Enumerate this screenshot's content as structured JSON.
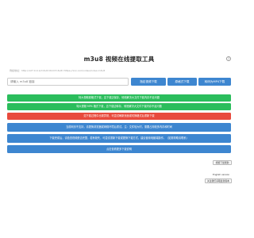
{
  "header": {
    "title": "m3u8 视频在线提取工具",
    "help_icon": "?"
  },
  "example_url": "例如地址：http://127.0.0.1/m3u8.html?m3u8=https://xxx.com/video/index.m3u8",
  "input": {
    "placeholder": "请输入 m3u8 链接"
  },
  "buttons": {
    "parse_download": "指定视频下载",
    "original_download": "原格式下载",
    "mp4_download": "转码为MP4下载"
  },
  "notices": [
    {
      "text": "特大视频原格式下载，边下载边保存，彻底解决大文件下载内存不足问题",
      "color": "green"
    },
    {
      "text": "特大视频 MP4 格式下载，边下载边转存，彻底解决大文件下载内存不足问题",
      "color": "green"
    },
    {
      "text": "如下载过程中出现异常，可尝试刷新页面或切换格式后重新下载",
      "color": "red"
    },
    {
      "text": "当前网页不支持，请更换浏览器或网络环境后重试。注：文件较大时，需要占用较多内存和时间",
      "color": "blue"
    },
    {
      "text": "下载完成后，请检查视频是否完整，若有缺失，可尝试重新下载或更换下载方式，建议使用电脑端操作。（如需帮助请联系）",
      "color": "blue"
    },
    {
      "text": "点击查看更多下载说明",
      "color": "blue"
    }
  ],
  "side": {
    "top_button": "视频下载帮助",
    "english_label": "English version",
    "bottom_button": "关注我们获取最新版本"
  },
  "colors": {
    "primary": "#3d86d0",
    "green": "#2bbd5c",
    "red": "#e84a3d"
  }
}
